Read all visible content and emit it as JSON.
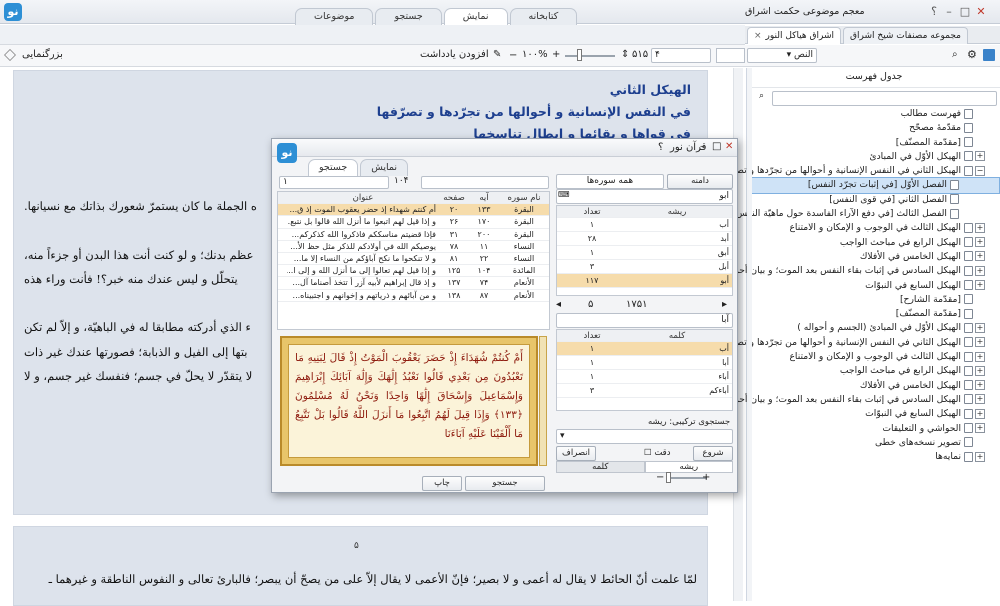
{
  "app": {
    "title": "معجم موضوعی حکمت اشراق",
    "help": "؟",
    "tabs": [
      "کتابخانه",
      "نمایش",
      "جستجو",
      "موضوعات"
    ],
    "active_tab": 1
  },
  "toolbar": {
    "zoom_label": "بزرگنمایی",
    "add_note": "افزودن یادداشت",
    "zoom_value": "۱۰۰%",
    "page_current": "۴",
    "page_total": "۵۱۵",
    "mode": "النص"
  },
  "right_tabs": {
    "items": [
      "مجموعه مصنفات شیخ اشراق",
      "اشراق هیاکل النور"
    ],
    "close": "×"
  },
  "main": {
    "heading1": "الهیکل الثاني",
    "heading2": "في النفس الإنسانية و أحوالها من تجرّدها و تصرّفها",
    "heading3": "في قواها و بقائها و إبطال تناسخها",
    "frag1": "ه الجملة ما كان يستمرّ شعورك بذاتك مع نسيانها.",
    "frag2": "عظم بدنك؛ و لو كنت أنت هذا البدن أو جزءاً منه،",
    "frag3": "يتحلّل و ليس عندك منه خبر؟! فأنت وراء هذه",
    "frag4": "ء الذي أدركته مطابقا له في الباهيّة، و إلاّ لم تكن",
    "frag5": "بتها إلى الفيل و الذبابة؛ فصورتها عندك غير ذات",
    "frag6": "لا يتقدّر لا يحلّ في جسم؛ فنفسك غير جسم، و لا",
    "page_number": "۵",
    "bottom_line": "لمّا علمت أنّ الحائط لا يقال له أعمى و لا بصير؛ فإنّ الأعمى لا يقال إلاّ على من يصحّ أن يبصر؛ فالبارئ تعالى و النفوس الناطقة و غيرهما ـ"
  },
  "toc": {
    "title": "جدول فهرست",
    "items": [
      {
        "label": "فهرست مطالب",
        "level": 0,
        "toggle": ""
      },
      {
        "label": "مقدّمهٔ مصحّح",
        "level": 0,
        "toggle": ""
      },
      {
        "label": "[مقدّمة المصنّف]",
        "level": 0,
        "toggle": ""
      },
      {
        "label": "الهیکل الأوّل في المبادئ",
        "level": 0,
        "toggle": "+"
      },
      {
        "label": "الهیکل الثاني في النفس الإنسانية و أحوالها من تجرّدها و تصرّفها في",
        "level": 0,
        "toggle": "−"
      },
      {
        "label": "الفصل الأوّل [في إثبات تجرّد النفس]",
        "level": 1,
        "toggle": "",
        "selected": true
      },
      {
        "label": "الفصل الثاني [في قوى النفس]",
        "level": 1,
        "toggle": ""
      },
      {
        "label": "الفصل الثالث [في دفع الآراء الفاسدة حول ماهيّة النفس]",
        "level": 1,
        "toggle": ""
      },
      {
        "label": "الهیکل الثالث في الوجوب و الإمكان و الامتناع",
        "level": 0,
        "toggle": "+"
      },
      {
        "label": "الهیکل الرابع في مباحث الواجب",
        "level": 0,
        "toggle": "+"
      },
      {
        "label": "الهیکل الخامس في الأفلاك",
        "level": 0,
        "toggle": "+"
      },
      {
        "label": "الهیکل السادس في إثبات بقاء النفس بعد الموت؛ و بیان أحوالها",
        "level": 0,
        "toggle": "+"
      },
      {
        "label": "الهیکل السابع في النبوّات",
        "level": 0,
        "toggle": "+"
      },
      {
        "label": "[مقدّمة الشارح]",
        "level": 0,
        "toggle": ""
      },
      {
        "label": "[مقدّمة المصنّف]",
        "level": 0,
        "toggle": ""
      },
      {
        "label": "الهیکل الأوّل في المبادئ (الجسم و أحواله )",
        "level": 0,
        "toggle": "+"
      },
      {
        "label": "الهیکل الثاني في النفس الإنسانية و أحوالها من تجرّدها و تصرّفها في قواه",
        "level": 0,
        "toggle": "+"
      },
      {
        "label": "الهیکل الثالث في الوجوب و الإمكان و الامتناع",
        "level": 0,
        "toggle": "+"
      },
      {
        "label": "الهیکل الرابع في مباحث الواجب",
        "level": 0,
        "toggle": "+"
      },
      {
        "label": "الهیکل الخامس في الأفلاك",
        "level": 0,
        "toggle": "+"
      },
      {
        "label": "الهیکل السادس في إثبات بقاء النفس بعد الموت؛ و بیان أحوالها",
        "level": 0,
        "toggle": "+"
      },
      {
        "label": "الهیکل السابع في النبوّات",
        "level": 0,
        "toggle": "+"
      },
      {
        "label": "الحواشي و التعليقات",
        "level": 0,
        "toggle": "+"
      },
      {
        "label": "تصویر نسخه‌های خطی",
        "level": 0,
        "toggle": ""
      },
      {
        "label": "نمایه‌ها",
        "level": 0,
        "toggle": "+"
      }
    ]
  },
  "dialog": {
    "title": "قرآن نور",
    "tabs": [
      "جستجو",
      "نمایش"
    ],
    "active_tab": 0,
    "range_left": "۱",
    "range_current": "۱۰۴",
    "search_type": "دامنه",
    "surah_scope": "همه سوره‌ها",
    "root_search": "ابو",
    "results_headers": [
      "نام سوره",
      "آیه",
      "صفحه",
      "عنوان"
    ],
    "results": [
      [
        "البقرة",
        "۱۳۳",
        "۲۰",
        "أم كنتم شهداء إذ حضر يعقوب الموت إذ ق..."
      ],
      [
        "البقرة",
        "۱۷۰",
        "۲۶",
        "و إذا قيل لهم اتبعوا ما أنزل الله قالوا بل نتبع..."
      ],
      [
        "البقرة",
        "۲۰۰",
        "۳۱",
        "فإذا قضيتم مناسككم فاذكروا الله كذكركم..."
      ],
      [
        "النساء",
        "۱۱",
        "۷۸",
        "يوصيكم الله في أولادكم للذكر مثل حظ الأ..."
      ],
      [
        "النساء",
        "۲۲",
        "۸۱",
        "و لا تنكحوا ما نكح آباؤكم من النساء إلا ما..."
      ],
      [
        "المائدة",
        "۱۰۴",
        "۱۲۵",
        "و إذا قيل لهم تعالوا إلى ما أنزل الله و إلى ا..."
      ],
      [
        "الأنعام",
        "۷۴",
        "۱۳۷",
        "و إذ قال إبراهيم لأبيه آزر أ تتخذ أصناما آل..."
      ],
      [
        "الأنعام",
        "۸۷",
        "۱۳۸",
        "و من آبائهم و ذرياتهم و إخوانهم و اجتبيناه..."
      ]
    ],
    "quran_text": "أَمْ كُنتُمْ شُهَدَاءَ إِذْ حَضَرَ يَعْقُوبَ الْمَوْتُ إِذْ قَالَ لِبَنِيهِ مَا تَعْبُدُونَ مِن بَعْدِي قَالُوا نَعْبُدُ إِلَٰهَكَ وَإِلَٰهَ آبَائِكَ إِبْرَاهِيمَ وَإِسْمَاعِيلَ وَإِسْحَاقَ إِلَٰهًا وَاحِدًا وَنَحْنُ لَهُ مُسْلِمُونَ ﴿١٣٣﴾ وَإِذَا قِيلَ لَهُمُ اتَّبِعُوا مَا أَنزَلَ اللَّهُ قَالُوا بَلْ نَتَّبِعُ مَا أَلْفَيْنَا عَلَيْهِ آبَاءَنَا",
    "root_headers": [
      "ریشه",
      "تعداد"
    ],
    "roots": [
      [
        "أب",
        "۱"
      ],
      [
        "أبد",
        "۲۸"
      ],
      [
        "أبق",
        "۱"
      ],
      [
        "أبل",
        "۳"
      ],
      [
        "أبو",
        "۱۱۷"
      ]
    ],
    "pager_left": "۵",
    "pager_right": "۱۷۵۱",
    "word_search": "آبا",
    "word_headers": [
      "کلمه",
      "تعداد"
    ],
    "words": [
      [
        "أب",
        "۱"
      ],
      [
        "أبا",
        "۱"
      ],
      [
        "أباء",
        "۱"
      ],
      [
        "أباءكم",
        "۳"
      ]
    ],
    "combo_label": "جستجوی ترکیبی: ریشه",
    "start_btn": "شروع",
    "exact_label": "دقت",
    "spread_btn": "انصراف",
    "mode_tabs": [
      "ریشه",
      "کلمه"
    ],
    "search_btn": "جستجو",
    "print_btn": "چاپ"
  },
  "colors": {
    "accent": "#1d3f8f",
    "selection": "#f6dcab",
    "page_bg": "#dde3ec",
    "dialog_close": "#c0392b"
  }
}
